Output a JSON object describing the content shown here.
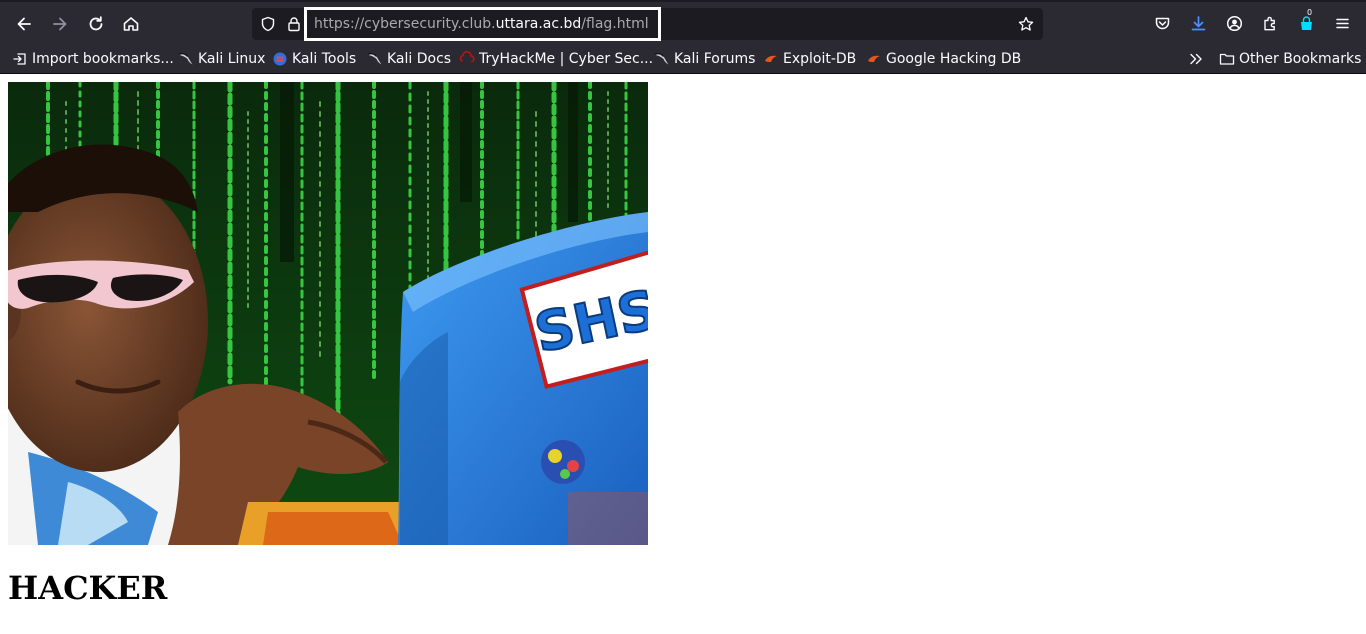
{
  "browser": {
    "url": {
      "prefix": "https://cybersecurity.club.",
      "domain": "uttara.ac.bd",
      "path": "/flag.html"
    },
    "extension_badge": "0",
    "bookmarks": [
      {
        "label": "Import bookmarks...",
        "icon": "import-icon"
      },
      {
        "label": "Kali Linux",
        "icon": "kali-dragon-icon"
      },
      {
        "label": "Kali Tools",
        "icon": "kali-tools-icon"
      },
      {
        "label": "Kali Docs",
        "icon": "kali-dragon-icon"
      },
      {
        "label": "TryHackMe | Cyber Sec...",
        "icon": "tryhackme-icon"
      },
      {
        "label": "Kali Forums",
        "icon": "kali-dragon-icon"
      },
      {
        "label": "Exploit-DB",
        "icon": "exploitdb-icon"
      },
      {
        "label": "Google Hacking DB",
        "icon": "exploitdb-icon"
      }
    ],
    "other_bookmarks": "Other Bookmarks"
  },
  "page": {
    "heading": "HACKER",
    "image": {
      "description_icon": "hacker-meme-image",
      "laptop_text": "SHS"
    }
  },
  "colors": {
    "toolbar": "#2b2a33",
    "urlbar": "#1c1b22",
    "accent": "#00ddff",
    "download": "#4a90ff"
  }
}
